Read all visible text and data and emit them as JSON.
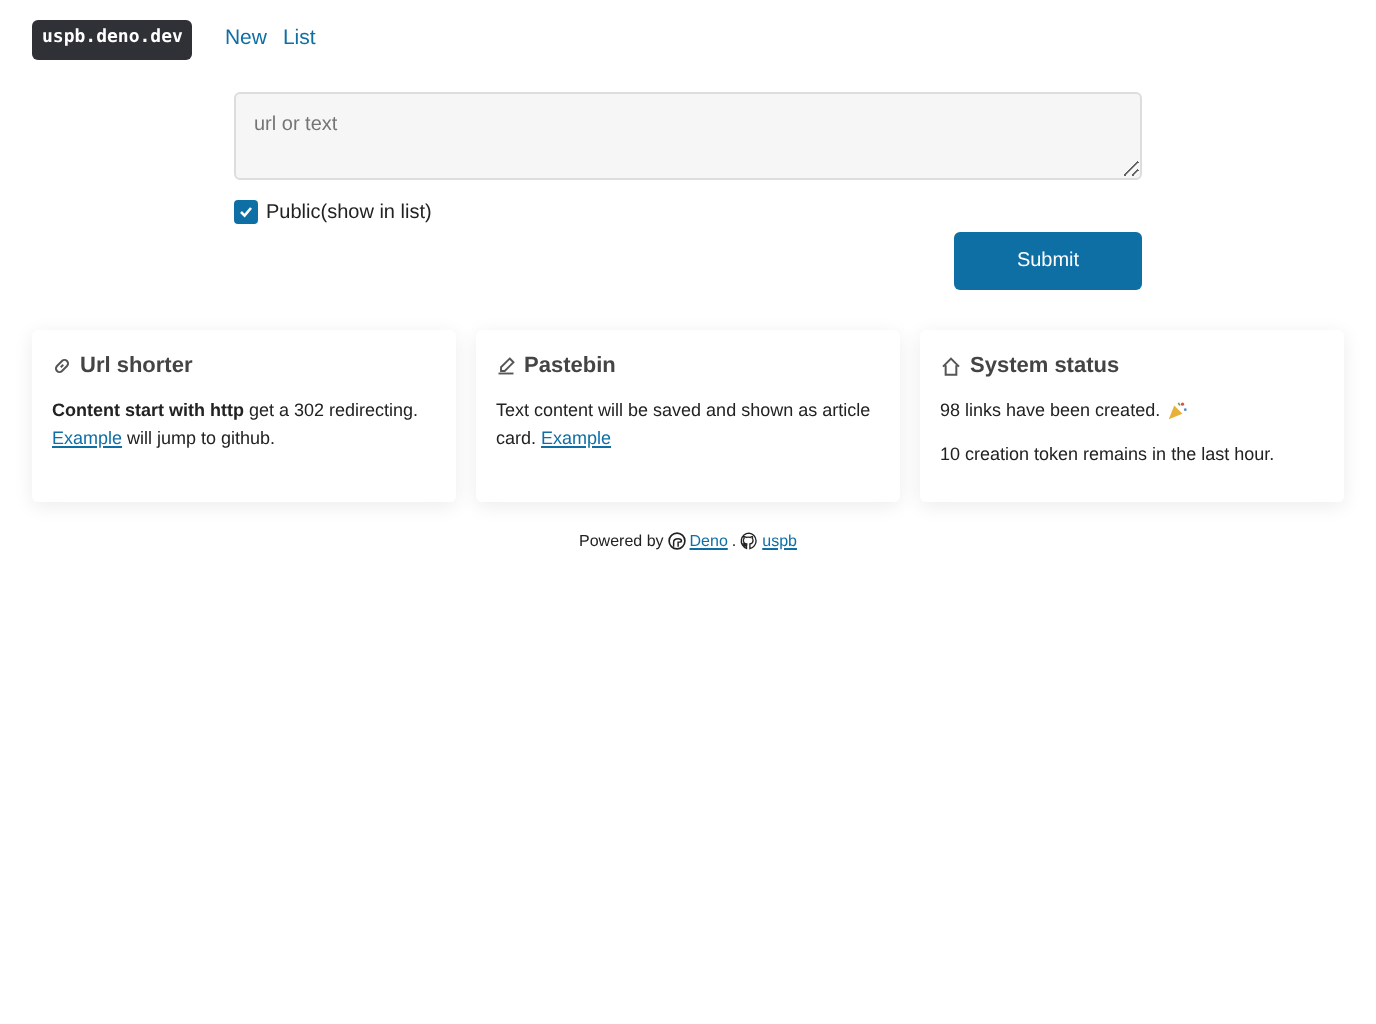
{
  "nav": {
    "brand": "uspb.deno.dev",
    "links": [
      "New",
      "List"
    ]
  },
  "form": {
    "placeholder": "url or text",
    "public": {
      "label": "Public(show in list)",
      "checked": true
    },
    "submit": "Submit"
  },
  "cards": [
    {
      "kind": "link",
      "title": "Url shorter",
      "paragraphs": [
        [
          {
            "kind": "text",
            "text": "**Content start with http** get a 302 redirecting. "
          },
          {
            "kind": "link",
            "text": "Example"
          },
          {
            "kind": "text",
            "text": " will jump to github."
          }
        ]
      ]
    },
    {
      "kind": "edit",
      "title": "Pastebin",
      "paragraphs": [
        [
          {
            "kind": "text",
            "text": "Text content will be saved and shown as article card. "
          },
          {
            "kind": "link",
            "text": "Example"
          }
        ]
      ]
    },
    {
      "kind": "status",
      "title": "System status",
      "paragraphs": [
        [
          {
            "kind": "text",
            "text": "98 links have been created. "
          },
          {
            "kind": "party"
          }
        ],
        [
          {
            "kind": "text",
            "text": "10 creation token remains in the last hour."
          }
        ]
      ]
    }
  ],
  "footer": [
    {
      "kind": "text",
      "text": "Powered by"
    },
    {
      "kind": "deno"
    },
    {
      "kind": "link",
      "text": "Deno"
    },
    {
      "kind": "text",
      "text": "."
    },
    {
      "kind": "github"
    },
    {
      "kind": "link",
      "text": "uspb"
    }
  ]
}
